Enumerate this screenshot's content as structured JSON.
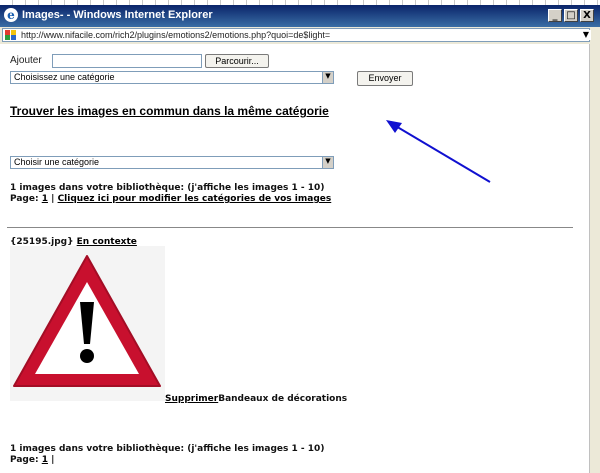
{
  "window": {
    "title": "Images- - Windows Internet Explorer",
    "address": "http://www.nifacile.com/rich2/plugins/emotions2/emotions.php?quoi=de$light=",
    "buttons": {
      "minimize": "_",
      "maximize": "□",
      "close": "X"
    },
    "addr_dropdown": "▼"
  },
  "form": {
    "ajouter_label": "Ajouter",
    "file_value": "",
    "browse_label": "Parcourir...",
    "category_select": "Choisissez une catégorie",
    "send_label": "Envoyer"
  },
  "find_link": "Trouver les images en commun dans la même catégorie",
  "filter_select": "Choisir une catégorie",
  "count_text": "1 images dans votre bibliothèque: (j'affiche les images 1 - 10)",
  "page_label": "Page:",
  "page_number": "1",
  "separator": "|",
  "modify_link": "Cliquez ici pour modifier les catégories de vos images",
  "image": {
    "filename": "{25195.jpg}",
    "context_link": "En contexte",
    "delete_link": "Supprimer",
    "category": "Bandeaux de décorations"
  },
  "footer": {
    "count_text": "1 images dans votre bibliothèque: (j'affiche les images 1 - 10)",
    "page_label": "Page:",
    "page_number": "1",
    "separator": "|"
  },
  "colors": {
    "titlebar": "#0a246a",
    "arrow": "#1010d0",
    "sign_red": "#c8102e"
  }
}
